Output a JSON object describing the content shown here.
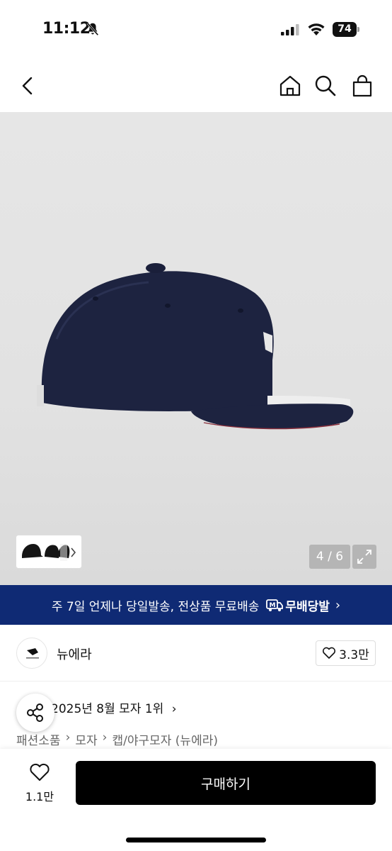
{
  "status_bar": {
    "time": "11:12",
    "battery": "74"
  },
  "gallery": {
    "counter": "4 / 6"
  },
  "banner": {
    "text": "주 7일 언제나 당일발송, 전상품 무료배송",
    "badge": "무배당발",
    "chevron": "›"
  },
  "brand": {
    "name": "뉴에라",
    "likes": "3.3만"
  },
  "ranking": {
    "text": "2025년 8월 모자 1위",
    "chevron": "›"
  },
  "breadcrumb": {
    "items": [
      "패션소품",
      "모자",
      "캡/야구모자 (뉴에라)"
    ],
    "separator": "›"
  },
  "bottom_bar": {
    "like_count": "1.1만",
    "buy_label": "구매하기"
  },
  "colors": {
    "banner": "#0f2a74",
    "buy_button": "#000000",
    "cap": "#1d2340"
  }
}
